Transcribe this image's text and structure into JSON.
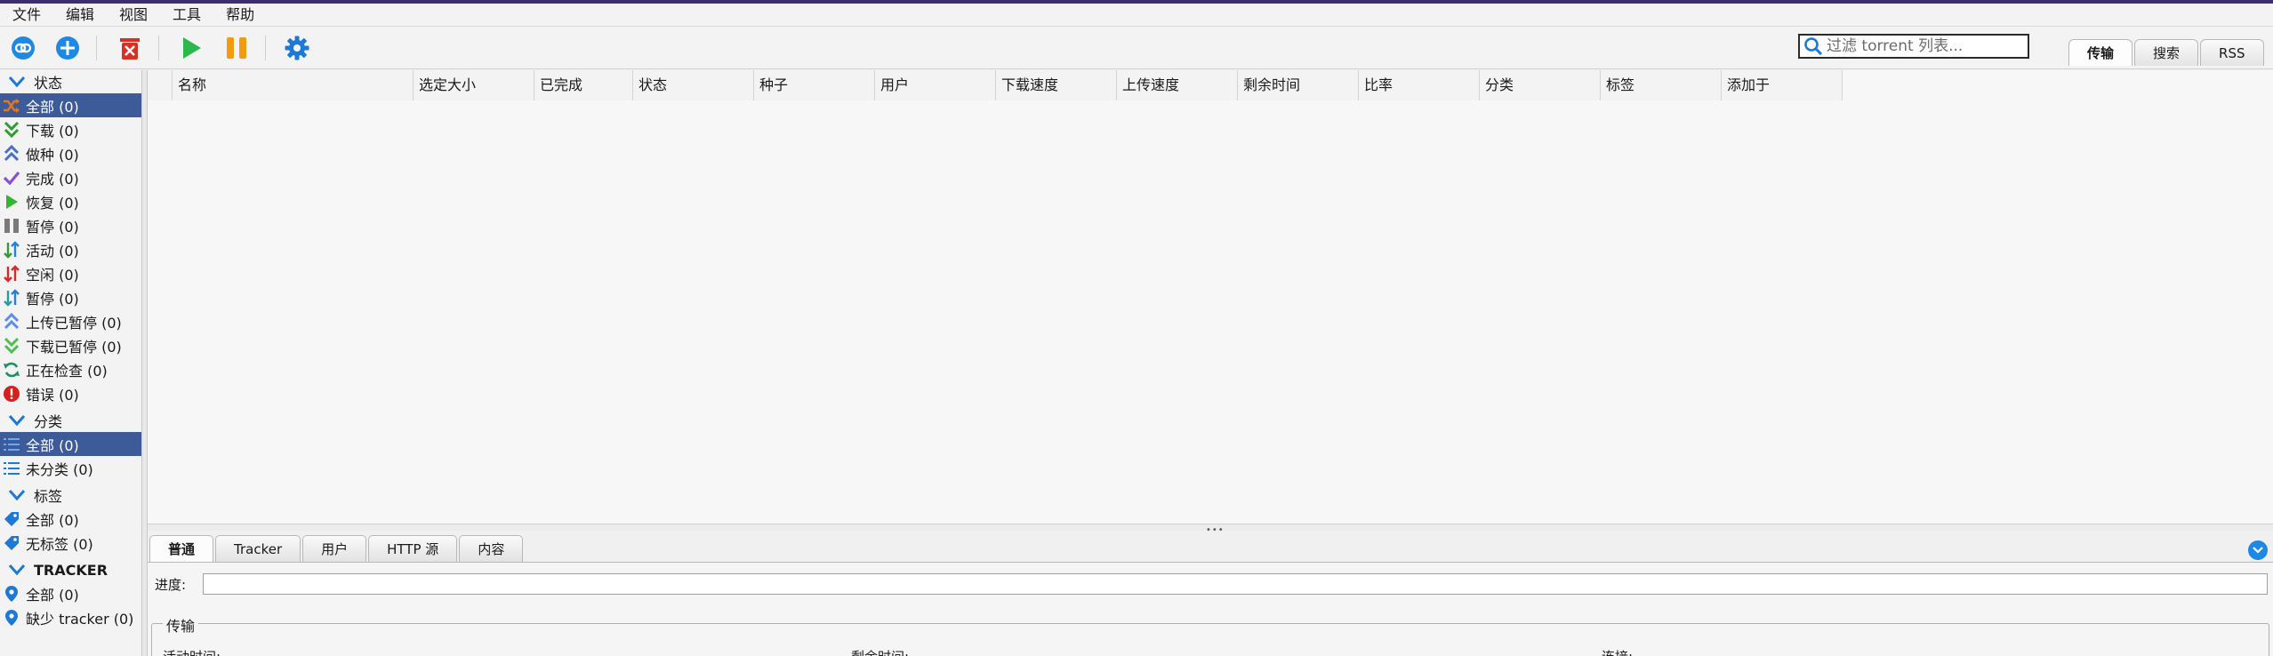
{
  "menubar": [
    "文件",
    "编辑",
    "视图",
    "工具",
    "帮助"
  ],
  "toolbar": {
    "search_placeholder": "过滤 torrent 列表...",
    "view_tabs": [
      "传输",
      "搜索",
      "RSS"
    ]
  },
  "sidebar": {
    "status": {
      "title": "状态",
      "items": [
        {
          "label": "全部 (0)",
          "icon": "shuffle-icon",
          "color": "#e8761c"
        },
        {
          "label": "下载 (0)",
          "icon": "double-chevron-down-icon",
          "color": "#2e9e2e"
        },
        {
          "label": "做种 (0)",
          "icon": "double-chevron-up-icon",
          "color": "#4a6fc9"
        },
        {
          "label": "完成 (0)",
          "icon": "checkmark-icon",
          "color": "#8a4fd8"
        },
        {
          "label": "恢复 (0)",
          "icon": "play-icon",
          "color": "#2eb82e"
        },
        {
          "label": "暂停 (0)",
          "icon": "pause-icon",
          "color": "#7a7a7a"
        },
        {
          "label": "活动 (0)",
          "icon": "updown-arrows-icon",
          "color": "#2a7fd6"
        },
        {
          "label": "空闲 (0)",
          "icon": "updown-arrows-red-icon",
          "color": "#d62a2a"
        },
        {
          "label": "暂停 (0)",
          "icon": "updown-arrows-teal-icon",
          "color": "#20a0a0"
        },
        {
          "label": "上传已暂停 (0)",
          "icon": "double-chevron-up-light-icon",
          "color": "#5b8ee6"
        },
        {
          "label": "下载已暂停 (0)",
          "icon": "double-chevron-down-light-icon",
          "color": "#4fbf4f"
        },
        {
          "label": "正在检查 (0)",
          "icon": "refresh-icon",
          "color": "#1b8f6b"
        },
        {
          "label": "错误 (0)",
          "icon": "error-icon",
          "color": "#d91e1e"
        }
      ]
    },
    "categories": {
      "title": "分类",
      "items": [
        {
          "label": "全部 (0)",
          "icon": "list-icon"
        },
        {
          "label": "未分类 (0)",
          "icon": "list-icon"
        }
      ]
    },
    "tags": {
      "title": "标签",
      "items": [
        {
          "label": "全部 (0)",
          "icon": "tag-icon"
        },
        {
          "label": "无标签 (0)",
          "icon": "tag-icon"
        }
      ]
    },
    "trackers": {
      "title": "TRACKER",
      "items": [
        {
          "label": "全部 (0)",
          "icon": "pin-icon"
        },
        {
          "label": "缺少 tracker (0)",
          "icon": "pin-icon"
        }
      ]
    }
  },
  "table": {
    "columns": [
      "名称",
      "选定大小",
      "已完成",
      "状态",
      "种子",
      "用户",
      "下载速度",
      "上传速度",
      "剩余时间",
      "比率",
      "分类",
      "标签",
      "添加于"
    ]
  },
  "detail": {
    "tabs": [
      "普通",
      "Tracker",
      "用户",
      "HTTP 源",
      "内容"
    ],
    "progress_label": "进度:",
    "progress_value": 0,
    "transfer_title": "传输",
    "fields": [
      "活动时间:",
      "剩余时间:",
      "连接:"
    ]
  }
}
